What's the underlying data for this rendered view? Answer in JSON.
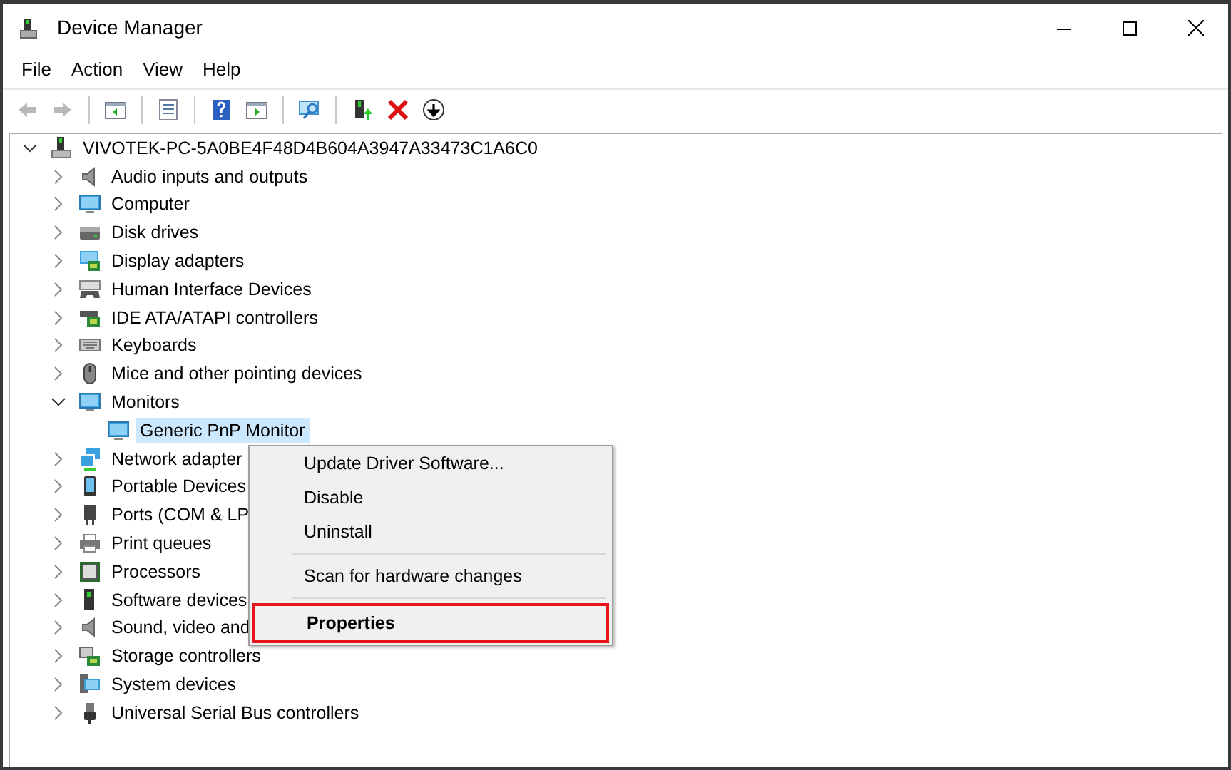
{
  "window": {
    "title": "Device Manager"
  },
  "menu_bar": [
    "File",
    "Action",
    "View",
    "Help"
  ],
  "toolbar": [
    {
      "kind": "back",
      "disabled": true
    },
    {
      "kind": "forward",
      "disabled": true
    },
    {
      "kind": "separator"
    },
    {
      "kind": "console-tree",
      "disabled": false
    },
    {
      "kind": "separator"
    },
    {
      "kind": "properties",
      "disabled": false
    },
    {
      "kind": "separator"
    },
    {
      "kind": "help",
      "disabled": false
    },
    {
      "kind": "action-pane",
      "disabled": false
    },
    {
      "kind": "separator"
    },
    {
      "kind": "scan",
      "disabled": false
    },
    {
      "kind": "separator"
    },
    {
      "kind": "update-driver",
      "disabled": false
    },
    {
      "kind": "uninstall",
      "disabled": false
    },
    {
      "kind": "enable",
      "disabled": false
    }
  ],
  "tree": {
    "label": "VIVOTEK-PC-5A0BE4F48D4B604A3947A33473C1A6C0",
    "kind": "computer-tower",
    "expanded": true,
    "selected": false,
    "children": [
      {
        "label": "Audio inputs and outputs",
        "kind": "speaker",
        "expanded": false,
        "selected": false
      },
      {
        "label": "Computer",
        "kind": "monitor",
        "expanded": false,
        "selected": false
      },
      {
        "label": "Disk drives",
        "kind": "disk",
        "expanded": false,
        "selected": false
      },
      {
        "label": "Display adapters",
        "kind": "display",
        "expanded": false,
        "selected": false
      },
      {
        "label": "Human Interface Devices",
        "kind": "hid",
        "expanded": false,
        "selected": false
      },
      {
        "label": "IDE ATA/ATAPI controllers",
        "kind": "ide",
        "expanded": false,
        "selected": false
      },
      {
        "label": "Keyboards",
        "kind": "keyboard",
        "expanded": false,
        "selected": false
      },
      {
        "label": "Mice and other pointing devices",
        "kind": "mouse",
        "expanded": false,
        "selected": false
      },
      {
        "label": "Monitors",
        "kind": "monitor",
        "expanded": true,
        "selected": false,
        "children": [
          {
            "label": "Generic PnP Monitor",
            "kind": "monitor",
            "selected": true
          }
        ]
      },
      {
        "label": "Network adapter",
        "kind": "network",
        "expanded": false,
        "selected": false
      },
      {
        "label": "Portable Devices",
        "kind": "portable",
        "expanded": false,
        "selected": false
      },
      {
        "label": "Ports (COM & LP",
        "kind": "port",
        "expanded": false,
        "selected": false
      },
      {
        "label": "Print queues",
        "kind": "printer",
        "expanded": false,
        "selected": false
      },
      {
        "label": "Processors",
        "kind": "processor",
        "expanded": false,
        "selected": false
      },
      {
        "label": "Software devices",
        "kind": "tower",
        "expanded": false,
        "selected": false
      },
      {
        "label": "Sound, video and",
        "kind": "speaker",
        "expanded": false,
        "selected": false
      },
      {
        "label": "Storage controllers",
        "kind": "storage",
        "expanded": false,
        "selected": false
      },
      {
        "label": "System devices",
        "kind": "system",
        "expanded": false,
        "selected": false
      },
      {
        "label": "Universal Serial Bus controllers",
        "kind": "usb",
        "expanded": false,
        "selected": false
      }
    ]
  },
  "context_menu": [
    {
      "kind": "item",
      "label": "Update Driver Software...",
      "default": false,
      "highlighted": false
    },
    {
      "kind": "item",
      "label": "Disable",
      "default": false,
      "highlighted": false
    },
    {
      "kind": "item",
      "label": "Uninstall",
      "default": false,
      "highlighted": false
    },
    {
      "kind": "separator"
    },
    {
      "kind": "item",
      "label": "Scan for hardware changes",
      "default": false,
      "highlighted": false
    },
    {
      "kind": "separator"
    },
    {
      "kind": "item",
      "label": "Properties",
      "default": true,
      "highlighted": true
    }
  ]
}
